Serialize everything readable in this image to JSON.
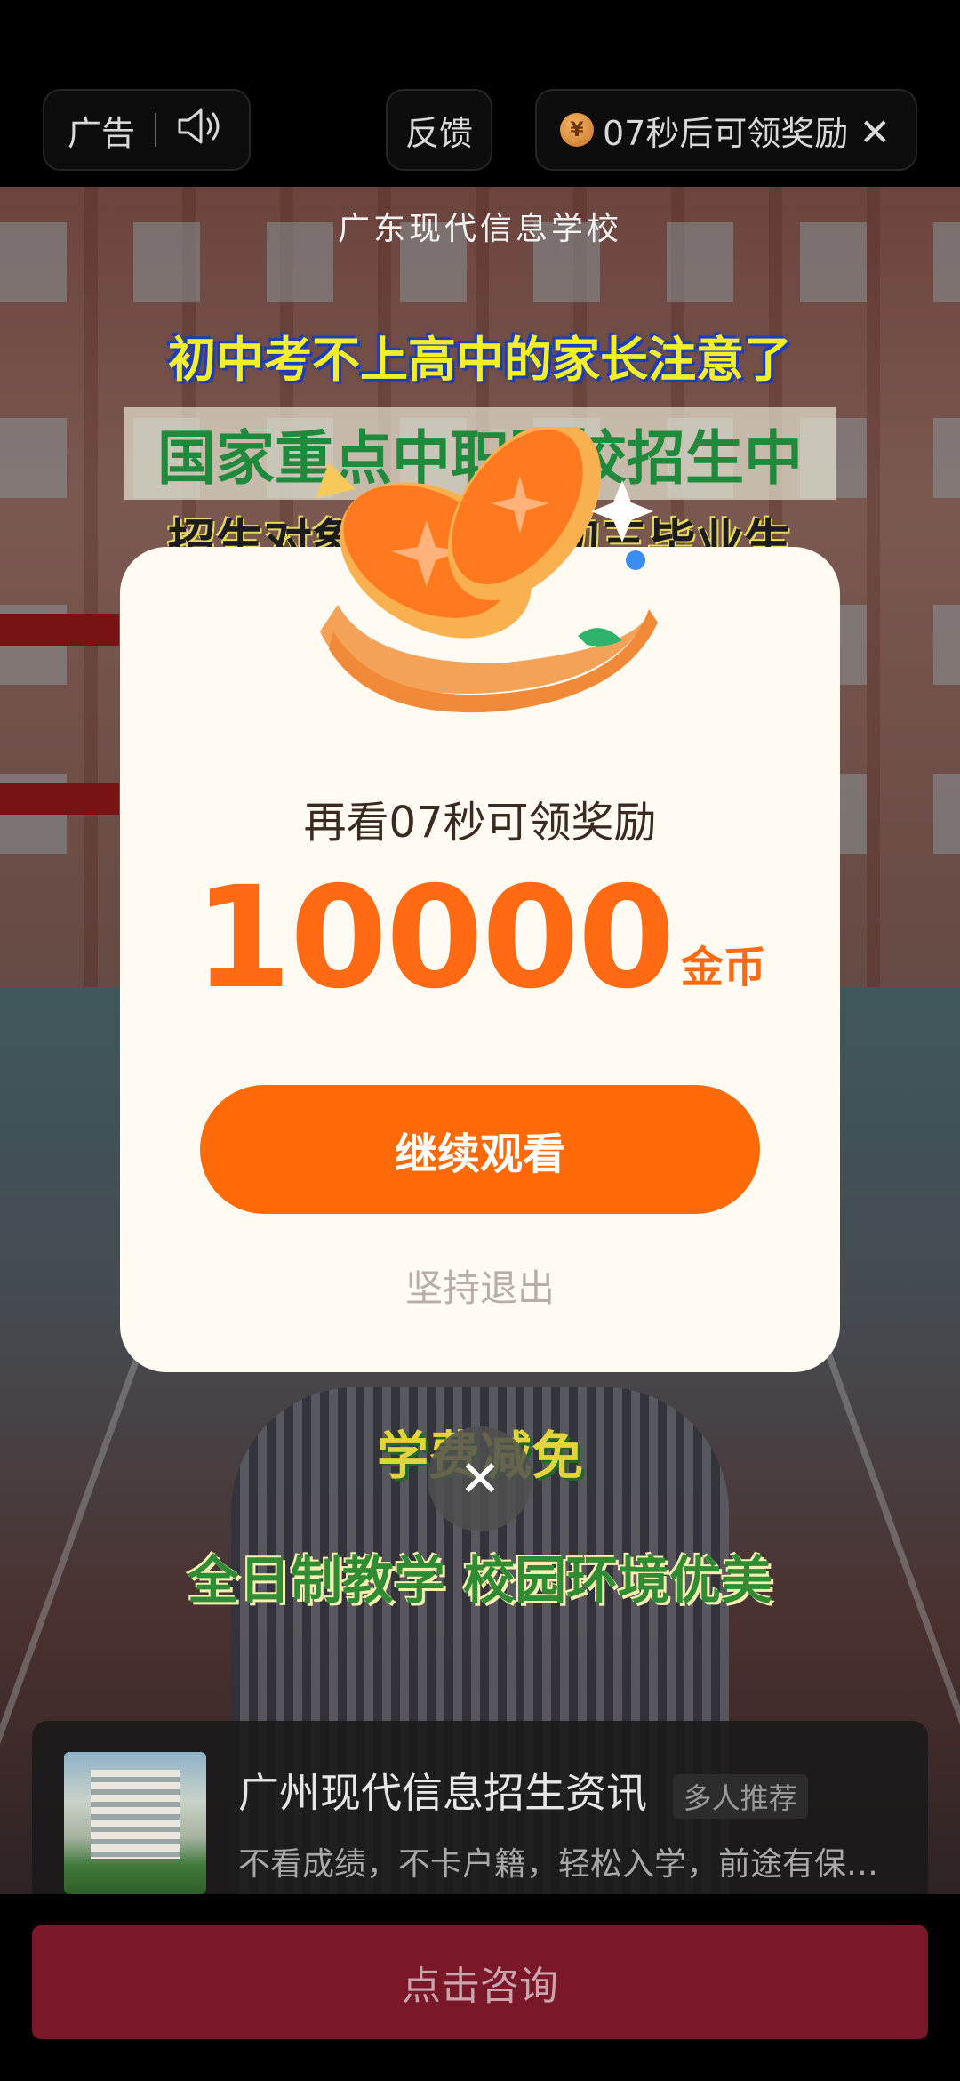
{
  "topbar": {
    "ad_label": "广告",
    "feedback_label": "反馈",
    "timer_label": "07秒后可领奖励",
    "coin_glyph": "¥"
  },
  "ad": {
    "school_name": "广东现代信息学校",
    "line1": "初中考不上高中的家长注意了",
    "line2": "国家重点中职院校招生中",
    "line3": "招生对象：应往届初三毕业生",
    "line4": "学费减免",
    "line5": "全日制教学 校园环境优美"
  },
  "modal": {
    "subtitle": "再看07秒可领奖励",
    "amount": "10000",
    "unit": "金币",
    "continue_label": "继续观看",
    "quit_label": "坚持退出"
  },
  "info_card": {
    "title": "广州现代信息招生资讯",
    "tag": "多人推荐",
    "description": "不看成绩，不卡户籍，轻松入学，前途有保…"
  },
  "cta": {
    "label": "点击咨询"
  },
  "colors": {
    "accent_orange": "#ff6a09",
    "cta_red": "#7a1729",
    "modal_bg": "#fffaf2"
  }
}
